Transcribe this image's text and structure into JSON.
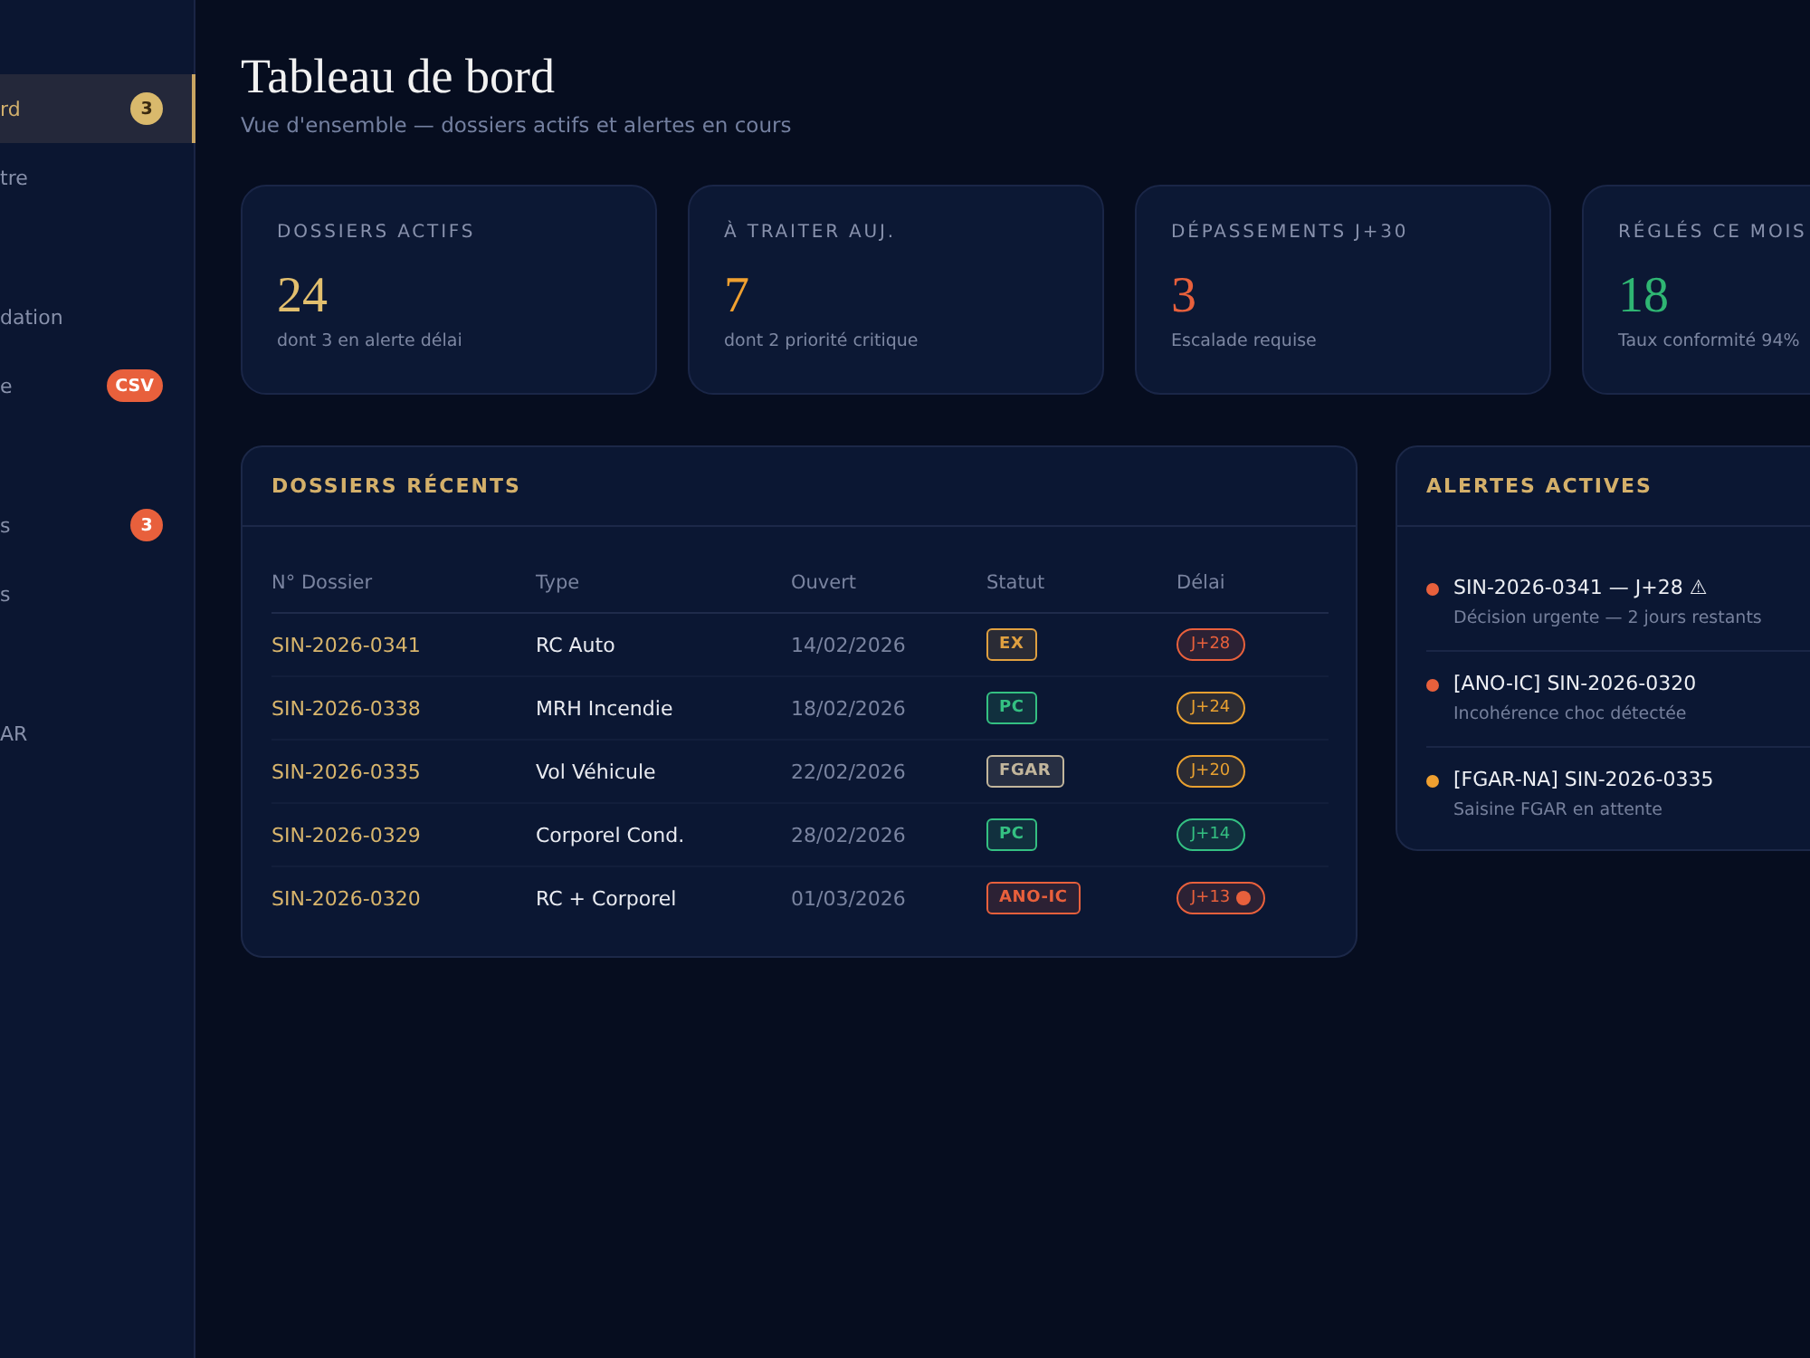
{
  "sidebar": {
    "sections": [
      {
        "items": [
          {
            "label": "rd",
            "selected": true,
            "badge": {
              "text": "3",
              "color": "#d9b96c"
            }
          },
          {
            "label": "tre",
            "selected": false
          }
        ]
      },
      {
        "items": [
          {
            "label": "dation",
            "selected": false
          },
          {
            "label": "e",
            "selected": false,
            "badge": {
              "text": "CSV",
              "color": "#e8603c"
            }
          }
        ]
      },
      {
        "items": [
          {
            "label": "s",
            "selected": false,
            "badge": {
              "text": "3",
              "color": "#e8603c"
            }
          },
          {
            "label": "s",
            "selected": false
          }
        ]
      },
      {
        "items": [
          {
            "label": "AR",
            "selected": false
          }
        ]
      }
    ]
  },
  "header": {
    "title": "Tableau de bord",
    "subtitle": "Vue d'ensemble — dossiers actifs et alertes en cours"
  },
  "stats": [
    {
      "label": "DOSSIERS ACTIFS",
      "value": "24",
      "note": "dont 3 en alerte délai",
      "color": "#e2bf6e"
    },
    {
      "label": "À TRAITER AUJ.",
      "value": "7",
      "note": "dont 2 priorité critique",
      "color": "#f0a030"
    },
    {
      "label": "DÉPASSEMENTS J+30",
      "value": "3",
      "note": "Escalade requise",
      "color": "#e8603c"
    },
    {
      "label": "RÉGLÉS CE MOIS",
      "value": "18",
      "note": "Taux conformité 94%",
      "color": "#2fb673"
    }
  ],
  "recent": {
    "title": "DOSSIERS RÉCENTS",
    "columns": [
      "N° Dossier",
      "Type",
      "Ouvert",
      "Statut",
      "Délai"
    ],
    "rows": [
      {
        "id": "SIN-2026-0341",
        "type": "RC Auto",
        "opened": "14/02/2026",
        "status": {
          "text": "EX",
          "color": "#e0a040"
        },
        "delay": {
          "text": "J+28",
          "color": "#e8603c",
          "flagged": false
        }
      },
      {
        "id": "SIN-2026-0338",
        "type": "MRH Incendie",
        "opened": "18/02/2026",
        "status": {
          "text": "PC",
          "color": "#34c082"
        },
        "delay": {
          "text": "J+24",
          "color": "#e8a030",
          "flagged": false
        }
      },
      {
        "id": "SIN-2026-0335",
        "type": "Vol Véhicule",
        "opened": "22/02/2026",
        "status": {
          "text": "FGAR",
          "color": "#c2b69c"
        },
        "delay": {
          "text": "J+20",
          "color": "#e8a030",
          "flagged": false
        }
      },
      {
        "id": "SIN-2026-0329",
        "type": "Corporel Cond.",
        "opened": "28/02/2026",
        "status": {
          "text": "PC",
          "color": "#34c082"
        },
        "delay": {
          "text": "J+14",
          "color": "#34c082",
          "flagged": false
        }
      },
      {
        "id": "SIN-2026-0320",
        "type": "RC + Corporel",
        "opened": "01/03/2026",
        "status": {
          "text": "ANO-IC",
          "color": "#e8603c"
        },
        "delay": {
          "text": "J+13",
          "color": "#e8603c",
          "flagged": true
        }
      }
    ]
  },
  "alerts": {
    "title": "ALERTES ACTIVES",
    "items": [
      {
        "title": "SIN-2026-0341 — J+28 ⚠",
        "detail": "Décision urgente — 2 jours restants",
        "color": "#e8603c"
      },
      {
        "title": "[ANO-IC] SIN-2026-0320",
        "detail": "Incohérence choc détectée",
        "color": "#e8603c"
      },
      {
        "title": "[FGAR-NA] SIN-2026-0335",
        "detail": "Saisine FGAR en attente",
        "color": "#f0a030"
      }
    ]
  }
}
